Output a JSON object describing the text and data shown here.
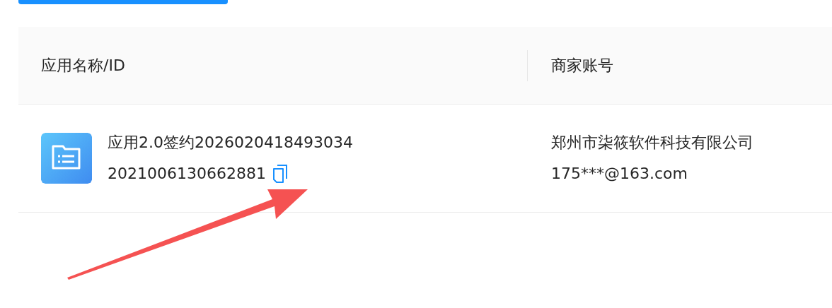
{
  "table": {
    "columns": [
      "应用名称/ID",
      "商家账号"
    ],
    "rows": [
      {
        "app_name": "应用2.0签约2026020418493034",
        "app_id": "2021006130662881",
        "merchant_name": "郑州市柒筱软件科技有限公司",
        "merchant_account": "175***@163.com"
      }
    ]
  }
}
